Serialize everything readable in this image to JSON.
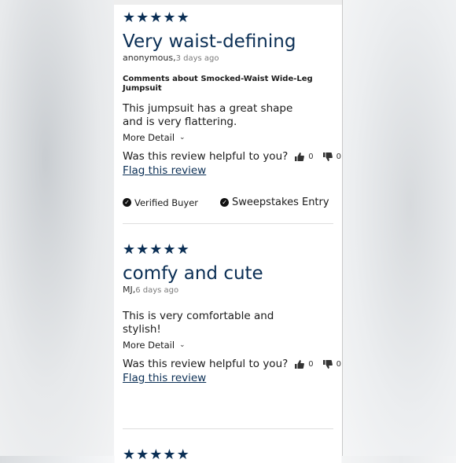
{
  "reviews": [
    {
      "rating": 5,
      "title": "Very waist-defining",
      "author": "anonymous,",
      "date": "3 days ago",
      "comments_about": "Comments about Smocked-Waist Wide-Leg Jumpsuit",
      "body": "This jumpsuit has a great shape and is very flattering.",
      "more_detail": "More Detail",
      "helpful_question": "Was this review helpful to you?",
      "helpful_yes": "0",
      "helpful_no": "0",
      "flag": "Flag this review",
      "badges": [
        "Verified Buyer",
        "Sweepstakes Entry"
      ]
    },
    {
      "rating": 5,
      "title": "comfy and cute",
      "author": "MJ,",
      "date": "6 days ago",
      "body": "This is very comfortable and stylish!",
      "more_detail": "More Detail",
      "helpful_question": "Was this review helpful to you?",
      "helpful_yes": "0",
      "helpful_no": "0",
      "flag": "Flag this review"
    }
  ],
  "colors": {
    "accent": "#0b2f55",
    "text": "#1a1a1a",
    "muted": "#7a7a7a"
  },
  "icons": {
    "star": "star-icon",
    "thumbs_up": "thumbs-up-icon",
    "thumbs_down": "thumbs-down-icon",
    "check": "check-circle-icon",
    "chevron": "chevron-down-icon"
  }
}
